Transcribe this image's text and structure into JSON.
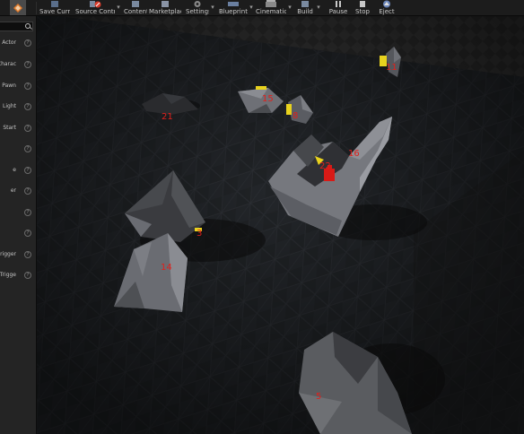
{
  "toolbar": {
    "buttons": [
      {
        "id": "new-level",
        "label": "Save Current"
      },
      {
        "id": "source-control",
        "label": "Source Control"
      },
      {
        "id": "content",
        "label": "Content"
      },
      {
        "id": "marketplace",
        "label": "Marketplace"
      },
      {
        "id": "settings",
        "label": "Settings"
      },
      {
        "id": "blueprints",
        "label": "Blueprints"
      },
      {
        "id": "cinematics",
        "label": "Cinematics"
      },
      {
        "id": "build",
        "label": "Build"
      },
      {
        "id": "pause",
        "label": "Pause"
      },
      {
        "id": "stop",
        "label": "Stop"
      },
      {
        "id": "eject",
        "label": "Eject"
      }
    ]
  },
  "modes_panel": {
    "search_placeholder": "",
    "items": [
      {
        "label": "Actor"
      },
      {
        "label": "Charac"
      },
      {
        "label": "Pawn"
      },
      {
        "label": "Light"
      },
      {
        "label": "Start"
      },
      {
        "label": ""
      },
      {
        "label": "e"
      },
      {
        "label": "er"
      },
      {
        "label": ""
      },
      {
        "label": ""
      },
      {
        "label": "rigger"
      },
      {
        "label": "e Trigge"
      }
    ],
    "help_glyph": "?"
  },
  "viewport": {
    "object_labels": [
      {
        "text": "21"
      },
      {
        "text": "15"
      },
      {
        "text": "8"
      },
      {
        "text": "11"
      },
      {
        "text": "16"
      },
      {
        "text": "22"
      },
      {
        "text": "3"
      },
      {
        "text": "14"
      },
      {
        "text": "5"
      }
    ],
    "colors": {
      "floor_tile": "#222426",
      "rock_light": "#8a8c92",
      "rock_dark": "#2a2b2e",
      "label_red": "#e0201c",
      "marker_yellow": "#e8d21e"
    }
  }
}
